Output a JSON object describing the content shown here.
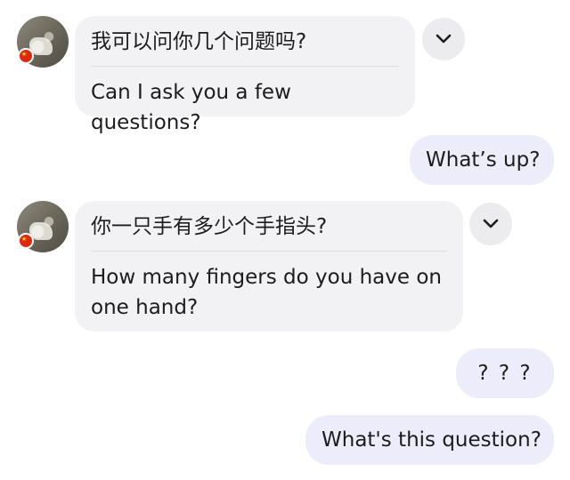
{
  "messages": [
    {
      "type": "incoming",
      "original": "我可以问你几个问题吗?",
      "translation": "Can I ask you a few questions?"
    },
    {
      "type": "outgoing",
      "text": "What’s up?"
    },
    {
      "type": "incoming",
      "original": "你一只手有多少个手指头?",
      "translation": "How many fingers do you have on one hand?"
    },
    {
      "type": "outgoing",
      "text": "? ? ?"
    },
    {
      "type": "outgoing",
      "text": "What's this question?"
    }
  ],
  "icons": {
    "avatar": "avatar",
    "flag": "china-flag-icon",
    "expand": "chevron-down-icon"
  },
  "colors": {
    "incoming_bubble": "#f2f2f4",
    "outgoing_bubble": "#ececfb",
    "flag_red": "#de2910",
    "flag_star": "#ffde00"
  }
}
